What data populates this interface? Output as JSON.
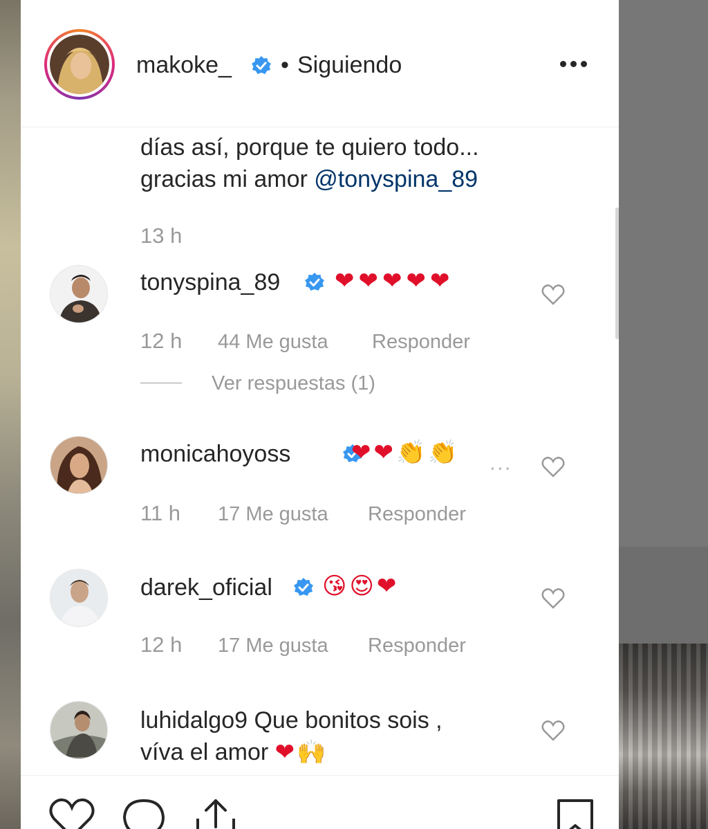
{
  "post": {
    "username": "makoke_",
    "separator": "•",
    "follow_status": "Siguiendo",
    "caption_line1": "días así, porque te quiero todo...",
    "caption_line2": "gracias mi amor ",
    "caption_mention": "@tonyspina_89",
    "caption_time": "13 h"
  },
  "comments": [
    {
      "username": "tonyspina_89",
      "emoji": "❤❤❤❤❤",
      "time": "12 h",
      "likes": "44 Me gusta",
      "reply": "Responder",
      "view_replies": "Ver respuestas (1)"
    },
    {
      "username": "monicahoyoss",
      "emoji": "❤❤👏👏",
      "more": "...",
      "time": "11 h",
      "likes": "17 Me gusta",
      "reply": "Responder"
    },
    {
      "username": "darek_oficial",
      "emoji": "😘😍❤",
      "time": "12 h",
      "likes": "17 Me gusta",
      "reply": "Responder"
    },
    {
      "username": "luhidalgo9",
      "text_line1": " Que bonitos sois ,",
      "text_line2": "víva el amor ",
      "emoji": "❤🙌"
    }
  ],
  "icons": {
    "verified": "verified-badge-icon",
    "like": "heart-icon",
    "comment": "comment-icon",
    "share": "share-icon",
    "save": "bookmark-icon",
    "more": "more-options-icon"
  },
  "colors": {
    "verified": "#3897f0",
    "mention": "#003569",
    "muted": "#999999",
    "text": "#262626",
    "heart": "#e0102a"
  }
}
